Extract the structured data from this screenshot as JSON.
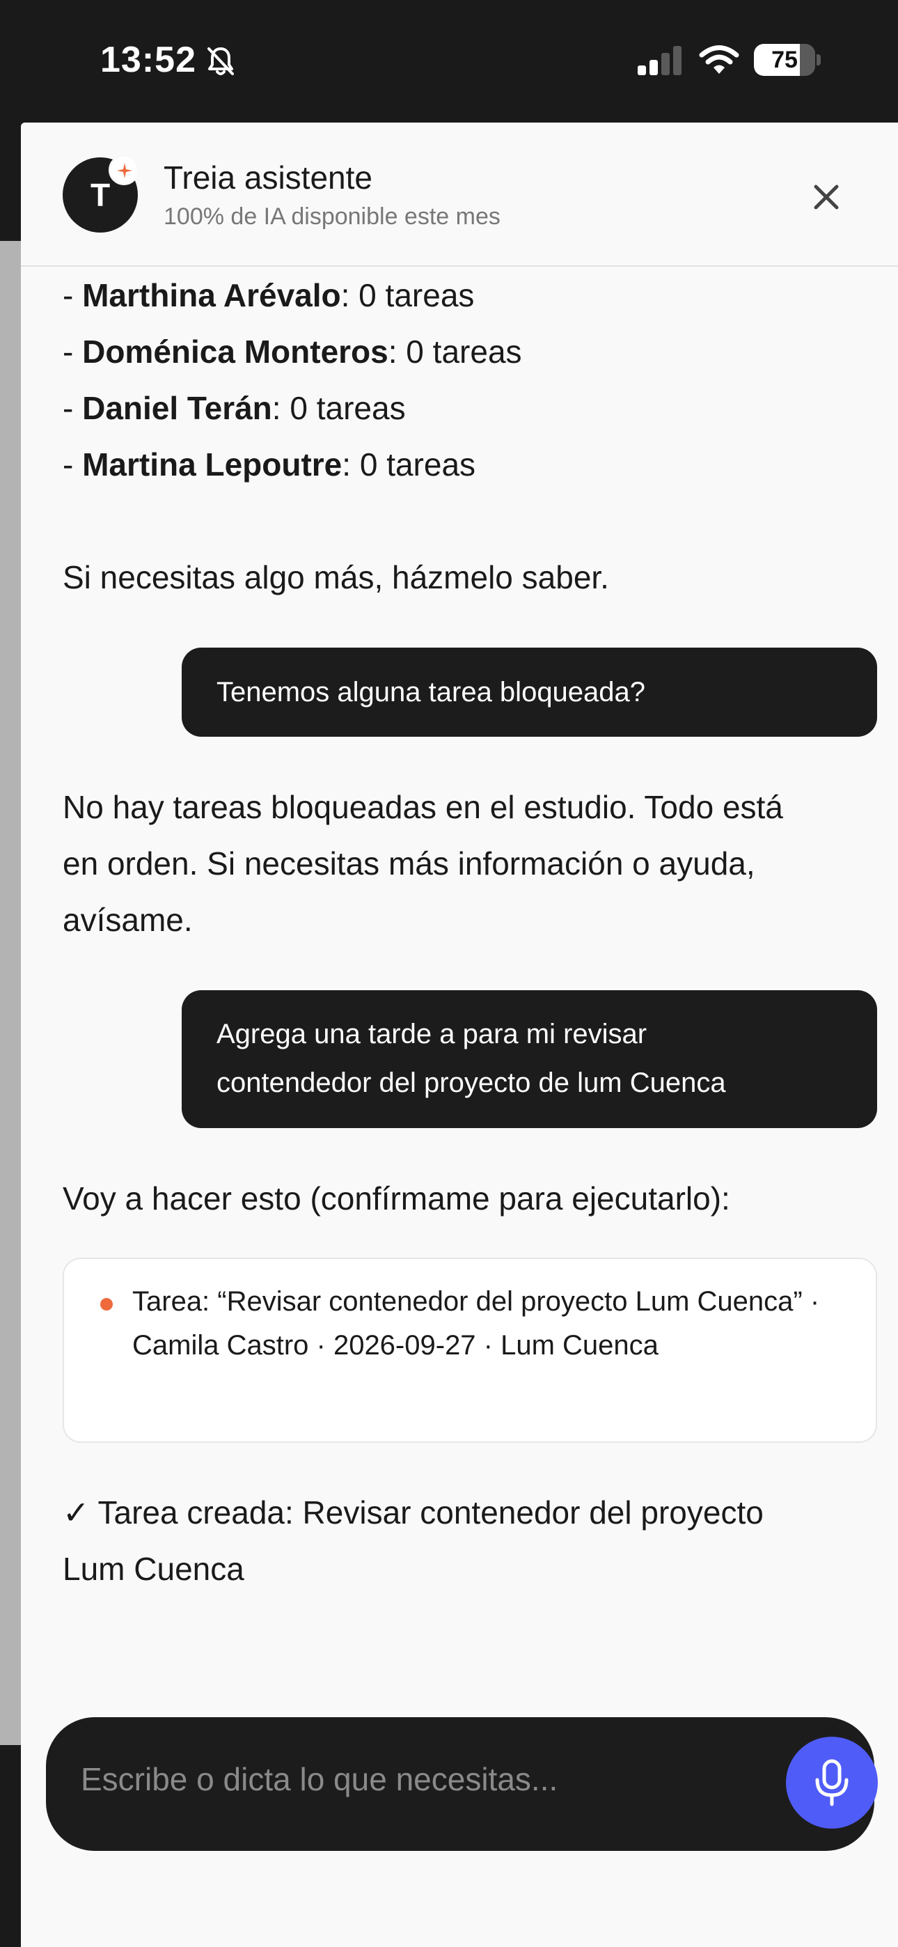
{
  "status_bar": {
    "time": "13:52",
    "battery_level": "75",
    "battery_fraction": 0.75,
    "icons": [
      "bell-slash-icon",
      "signal-icon",
      "wifi-icon",
      "battery-icon"
    ]
  },
  "header": {
    "avatar_letter": "T",
    "title": "Treia asistente",
    "subtitle": "100% de IA disponible este mes",
    "close_icon": "close-icon"
  },
  "messages": {
    "task_list": [
      {
        "prefix": "- ",
        "name": "Marthina Arévalo",
        "count": ": 0 tareas"
      },
      {
        "prefix": "- ",
        "name": "Doménica Monteros",
        "count": ": 0 tareas"
      },
      {
        "prefix": "- ",
        "name": "Daniel Terán",
        "count": ": 0 tareas"
      },
      {
        "prefix": "- ",
        "name": "Martina Lepoutre",
        "count": ": 0 tareas"
      }
    ],
    "assistant_followup": "Si necesitas algo más, házmelo saber.",
    "user_1": "Tenemos alguna tarea bloqueada?",
    "assistant_2_line1": "No hay tareas bloqueadas en el estudio. Todo está",
    "assistant_2_line2": "en orden. Si necesitas más información o ayuda,",
    "assistant_2_line3": "avísame.",
    "user_2_line1": "Agrega una tarde a para mi revisar",
    "user_2_line2": "contendedor del proyecto de lum Cuenca",
    "assistant_3": "Voy a hacer esto (confírmame para ejecutarlo):",
    "confirm_item": "Tarea: “Revisar contenedor del proyecto Lum Cuenca” · Camila Castro · 2026-09-27 · Lum Cuenca",
    "result_line1": "✓ Tarea creada: Revisar contenedor del proyecto",
    "result_line2": "Lum Cuenca"
  },
  "composer": {
    "placeholder": "Escribe o dicta lo que necesitas...",
    "mic_icon": "microphone-icon"
  },
  "colors": {
    "accent": "#4f5cf7",
    "bullet": "#ee6a3d",
    "dark": "#1c1c1c",
    "sheet_bg": "#f9f9f9"
  }
}
